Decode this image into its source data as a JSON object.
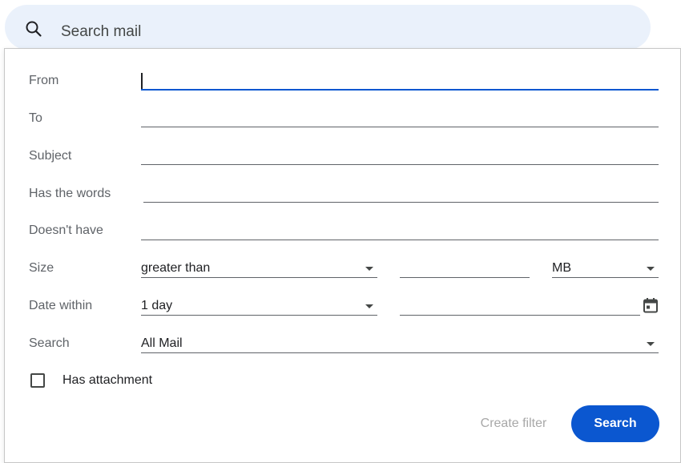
{
  "search": {
    "placeholder": "Search mail",
    "icon": "search-icon"
  },
  "form": {
    "from_label": "From",
    "to_label": "To",
    "subject_label": "Subject",
    "has_words_label": "Has the words",
    "doesnt_have_label": "Doesn't have",
    "size_label": "Size",
    "size_operator": "greater than",
    "size_unit": "MB",
    "date_within_label": "Date within",
    "date_within_value": "1 day",
    "search_label": "Search",
    "search_scope": "All Mail",
    "has_attachment_label": "Has attachment",
    "has_attachment_checked": false
  },
  "actions": {
    "create_filter_label": "Create filter",
    "search_button_label": "Search"
  },
  "colors": {
    "accent": "#0b57d0",
    "search_bar_bg": "#eaf1fb",
    "label": "#5f6368",
    "disabled": "#a8a8a8"
  }
}
